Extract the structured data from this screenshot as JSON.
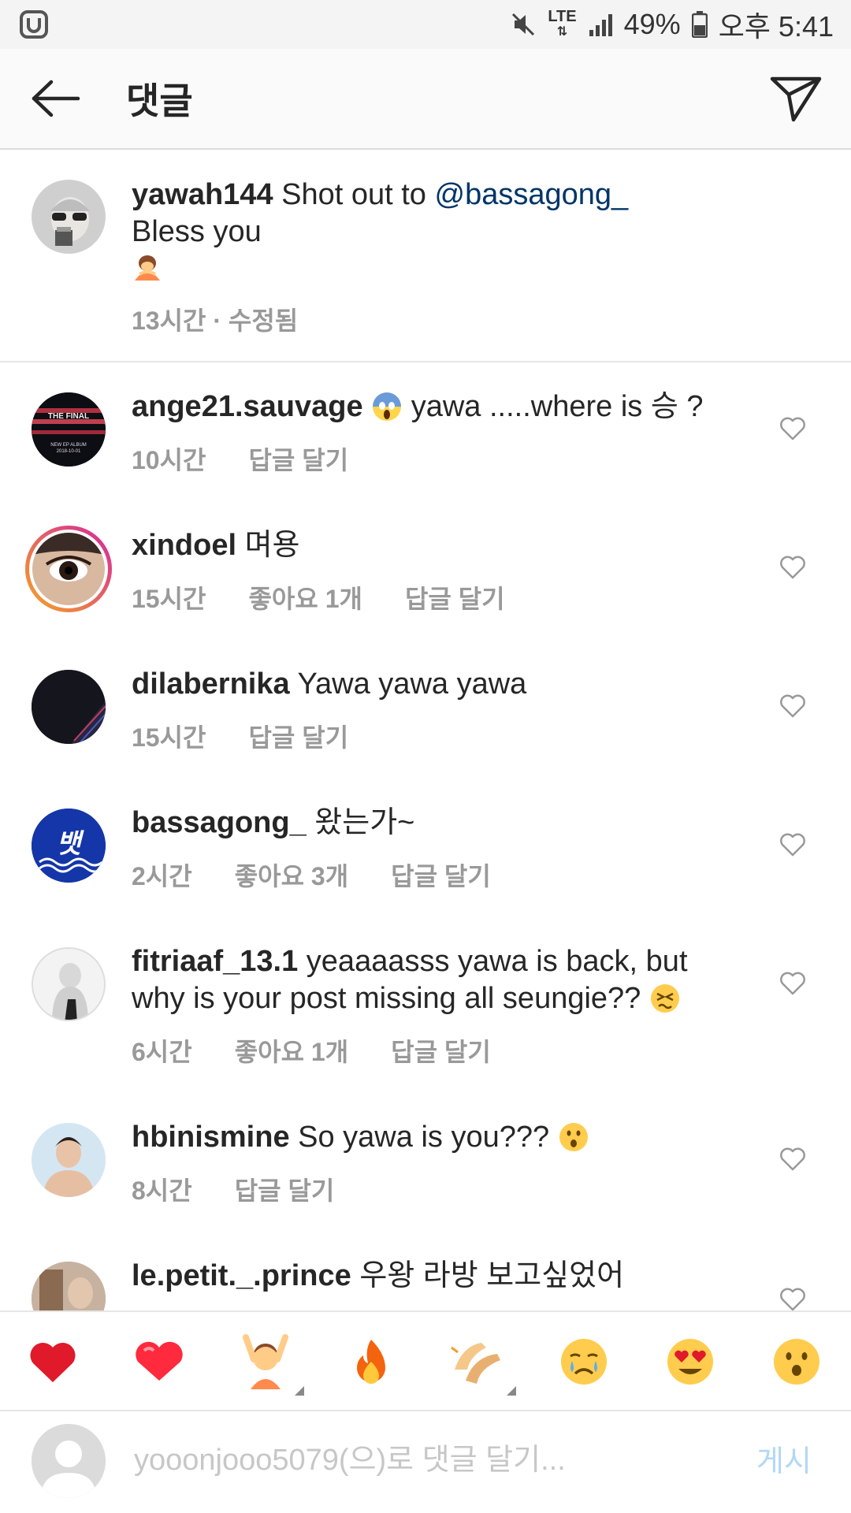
{
  "status_bar": {
    "battery": "49%",
    "time": "오후 5:41",
    "network": "LTE"
  },
  "header": {
    "title": "댓글"
  },
  "caption": {
    "username": "yawah144",
    "text": "Shot out to ",
    "mention": "@bassagong_",
    "line2": "Bless you",
    "time": "13시간",
    "separator": " · ",
    "edited": "수정됨"
  },
  "comments": [
    {
      "username": "ange21.sauvage",
      "text": "yawa .....where is 승 ?",
      "time": "10시간",
      "likes": "",
      "reply": "답글 달기"
    },
    {
      "username": "xindoel",
      "text": "며용",
      "time": "15시간",
      "likes": "좋아요 1개",
      "reply": "답글 달기"
    },
    {
      "username": "dilabernika",
      "text": "Yawa yawa yawa",
      "time": "15시간",
      "likes": "",
      "reply": "답글 달기"
    },
    {
      "username": "bassagong_",
      "text": "왔는가~",
      "time": "2시간",
      "likes": "좋아요 3개",
      "reply": "답글 달기"
    },
    {
      "username": "fitriaaf_13.1",
      "text": "yeaaaasss yawa is back, but",
      "text_line2": "why is your post missing all seungie??",
      "time": "6시간",
      "likes": "좋아요 1개",
      "reply": "답글 달기"
    },
    {
      "username": "hbinismine",
      "text": "So yawa is you???",
      "time": "8시간",
      "likes": "",
      "reply": "답글 달기"
    },
    {
      "username": "le.petit._.prince",
      "text": "우왕 라방 보고싶었어",
      "time": "",
      "likes": "",
      "reply": ""
    }
  ],
  "avatar_labels": {
    "ange21_line1": "THE FINAL",
    "ange21_line2": "NEW EP ALBUM",
    "ange21_line3": "2018-10-01",
    "bassagong": "뱃"
  },
  "emoji_bar": [
    {
      "name": "red-heart-icon"
    },
    {
      "name": "heart-icon"
    },
    {
      "name": "raising-hands-person-icon",
      "has_variants": true
    },
    {
      "name": "fire-icon"
    },
    {
      "name": "clapping-hands-icon",
      "has_variants": true
    },
    {
      "name": "crying-face-icon"
    },
    {
      "name": "heart-eyes-icon"
    },
    {
      "name": "surprised-face-icon"
    }
  ],
  "input": {
    "placeholder": "yooonjooo5079(으)로 댓글 달기...",
    "post_label": "게시"
  },
  "colors": {
    "mention": "#003569",
    "meta": "#999999",
    "post_disabled": "#b2d8f5",
    "story_ring_start": "#f5a623",
    "story_ring_end": "#d6249f"
  }
}
